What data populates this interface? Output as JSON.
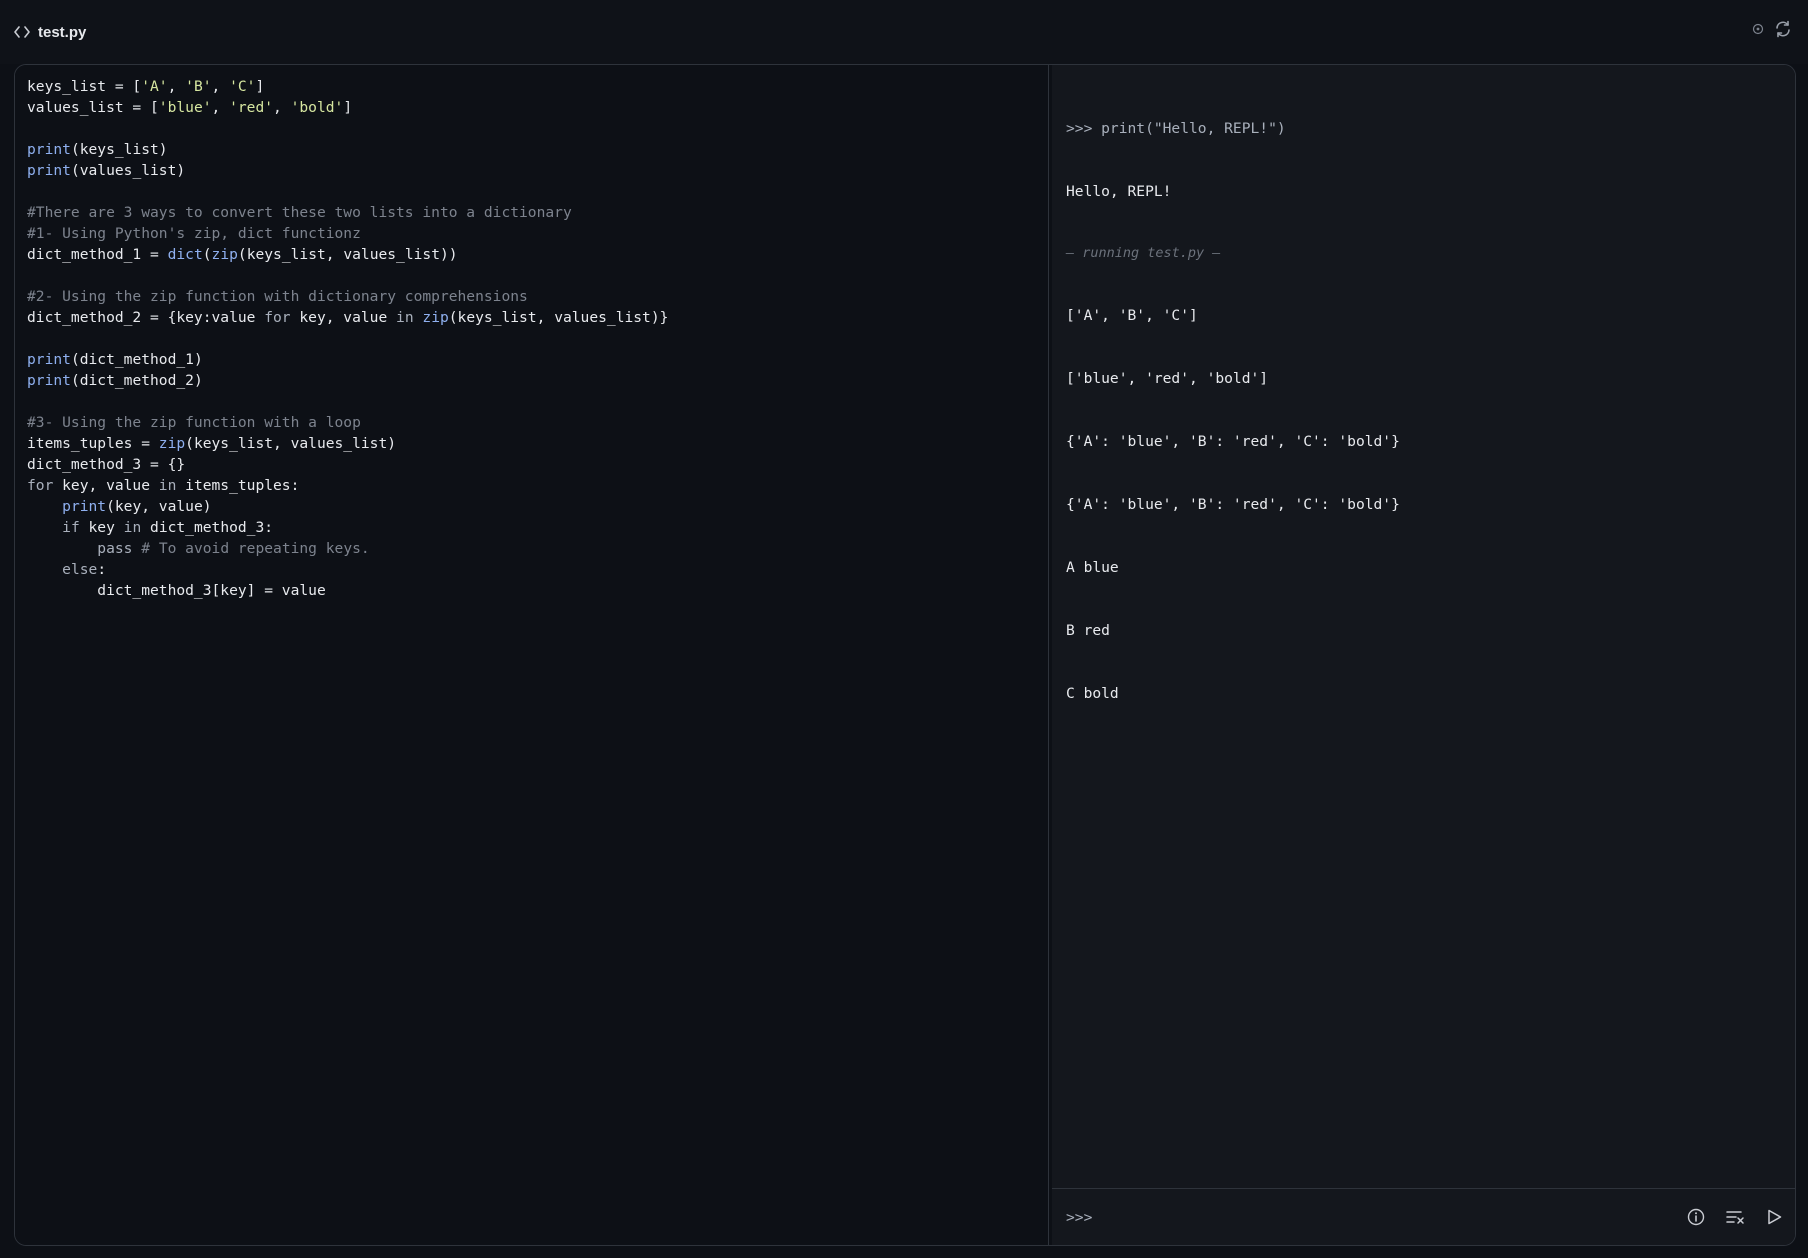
{
  "header": {
    "file_name": "test.py",
    "icons": [
      "code-icon",
      "circle-dot-icon",
      "refresh-icon"
    ]
  },
  "editor": {
    "lines": [
      [
        {
          "t": "keys_list = [",
          "c": "plain"
        },
        {
          "t": "'A'",
          "c": "str"
        },
        {
          "t": ", ",
          "c": "plain"
        },
        {
          "t": "'B'",
          "c": "str"
        },
        {
          "t": ", ",
          "c": "plain"
        },
        {
          "t": "'C'",
          "c": "str"
        },
        {
          "t": "]",
          "c": "plain"
        }
      ],
      [
        {
          "t": "values_list = [",
          "c": "plain"
        },
        {
          "t": "'blue'",
          "c": "str"
        },
        {
          "t": ", ",
          "c": "plain"
        },
        {
          "t": "'red'",
          "c": "str"
        },
        {
          "t": ", ",
          "c": "plain"
        },
        {
          "t": "'bold'",
          "c": "str"
        },
        {
          "t": "]",
          "c": "plain"
        }
      ],
      [],
      [
        {
          "t": "print",
          "c": "fn"
        },
        {
          "t": "(keys_list)",
          "c": "plain"
        }
      ],
      [
        {
          "t": "print",
          "c": "fn"
        },
        {
          "t": "(values_list)",
          "c": "plain"
        }
      ],
      [],
      [
        {
          "t": "#There are 3 ways to convert these two lists into a dictionary",
          "c": "com"
        }
      ],
      [
        {
          "t": "#1- Using Python's zip, dict functionz",
          "c": "com"
        }
      ],
      [
        {
          "t": "dict_method_1 = ",
          "c": "plain"
        },
        {
          "t": "dict",
          "c": "fn"
        },
        {
          "t": "(",
          "c": "plain"
        },
        {
          "t": "zip",
          "c": "fn"
        },
        {
          "t": "(keys_list, values_list))",
          "c": "plain"
        }
      ],
      [],
      [
        {
          "t": "#2- Using the zip function with dictionary comprehensions",
          "c": "com"
        }
      ],
      [
        {
          "t": "dict_method_2 = {key:value ",
          "c": "plain"
        },
        {
          "t": "for",
          "c": "kw"
        },
        {
          "t": " key, value ",
          "c": "plain"
        },
        {
          "t": "in",
          "c": "kw"
        },
        {
          "t": " ",
          "c": "plain"
        },
        {
          "t": "zip",
          "c": "fn"
        },
        {
          "t": "(keys_list, values_list)}",
          "c": "plain"
        }
      ],
      [],
      [
        {
          "t": "print",
          "c": "fn"
        },
        {
          "t": "(dict_method_1)",
          "c": "plain"
        }
      ],
      [
        {
          "t": "print",
          "c": "fn"
        },
        {
          "t": "(dict_method_2)",
          "c": "plain"
        }
      ],
      [],
      [
        {
          "t": "#3- Using the zip function with a loop",
          "c": "com"
        }
      ],
      [
        {
          "t": "items_tuples = ",
          "c": "plain"
        },
        {
          "t": "zip",
          "c": "fn"
        },
        {
          "t": "(keys_list, values_list)",
          "c": "plain"
        }
      ],
      [
        {
          "t": "dict_method_3 = {}",
          "c": "plain"
        }
      ],
      [
        {
          "t": "for",
          "c": "kw"
        },
        {
          "t": " key, value ",
          "c": "plain"
        },
        {
          "t": "in",
          "c": "kw"
        },
        {
          "t": " items_tuples:",
          "c": "plain"
        }
      ],
      [
        {
          "t": "    ",
          "c": "plain"
        },
        {
          "t": "print",
          "c": "fn"
        },
        {
          "t": "(key, value)",
          "c": "plain"
        }
      ],
      [
        {
          "t": "    ",
          "c": "plain"
        },
        {
          "t": "if",
          "c": "kw"
        },
        {
          "t": " key ",
          "c": "plain"
        },
        {
          "t": "in",
          "c": "kw"
        },
        {
          "t": " dict_method_3:",
          "c": "plain"
        }
      ],
      [
        {
          "t": "        ",
          "c": "plain"
        },
        {
          "t": "pass",
          "c": "kw"
        },
        {
          "t": " ",
          "c": "plain"
        },
        {
          "t": "# To avoid repeating keys.",
          "c": "com"
        }
      ],
      [
        {
          "t": "    ",
          "c": "plain"
        },
        {
          "t": "else",
          "c": "kw"
        },
        {
          "t": ":",
          "c": "plain"
        }
      ],
      [
        {
          "t": "        dict_method_3[key] = value",
          "c": "plain"
        }
      ]
    ]
  },
  "repl": {
    "prompt_command": ">>> print(\"Hello, REPL!\")",
    "hello_output": "Hello, REPL!",
    "running_label": "— running test.py —",
    "outputs": [
      "['A', 'B', 'C']",
      "['blue', 'red', 'bold']",
      "{'A': 'blue', 'B': 'red', 'C': 'bold'}",
      "{'A': 'blue', 'B': 'red', 'C': 'bold'}",
      "A blue",
      "B red",
      "C bold"
    ],
    "input_prompt": ">>>",
    "input_value": "",
    "action_icons": [
      "info-icon",
      "clear-output-icon",
      "run-icon"
    ]
  },
  "colors": {
    "background": "#0d1016",
    "repl_background": "#14171d",
    "border": "#2e333b",
    "function": "#8fb0f0",
    "string": "#d6e6a0",
    "comment": "#7d838e",
    "keyword": "#a9b0bc",
    "text": "#e8eaee"
  }
}
